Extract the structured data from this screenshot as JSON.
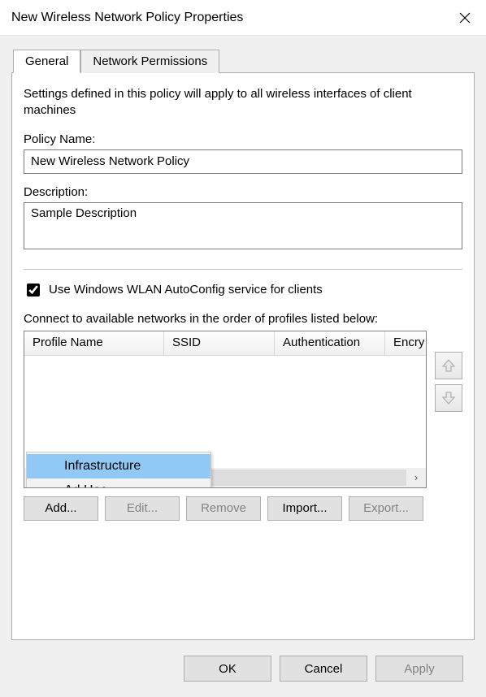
{
  "window": {
    "title": "New Wireless Network Policy Properties"
  },
  "tabs": {
    "general": "General",
    "network_permissions": "Network Permissions"
  },
  "general": {
    "settings_desc": "Settings defined in this policy will apply to all wireless interfaces of client machines",
    "policy_name_label": "Policy Name:",
    "policy_name_value": "New Wireless Network Policy",
    "description_label": "Description:",
    "description_value": "Sample Description",
    "autoconfig_label": "Use Windows WLAN AutoConfig service for clients",
    "autoconfig_checked": true,
    "connect_order_label": "Connect to available networks in the order of profiles listed below:",
    "columns": {
      "profile_name": "Profile Name",
      "ssid": "SSID",
      "authentication": "Authentication",
      "encryption": "Encry"
    },
    "profiles": [],
    "context_menu": {
      "infrastructure": "Infrastructure",
      "ad_hoc": "Ad Hoc"
    },
    "buttons": {
      "add": "Add...",
      "edit": "Edit...",
      "remove": "Remove",
      "import": "Import...",
      "export": "Export..."
    }
  },
  "footer": {
    "ok": "OK",
    "cancel": "Cancel",
    "apply": "Apply"
  }
}
